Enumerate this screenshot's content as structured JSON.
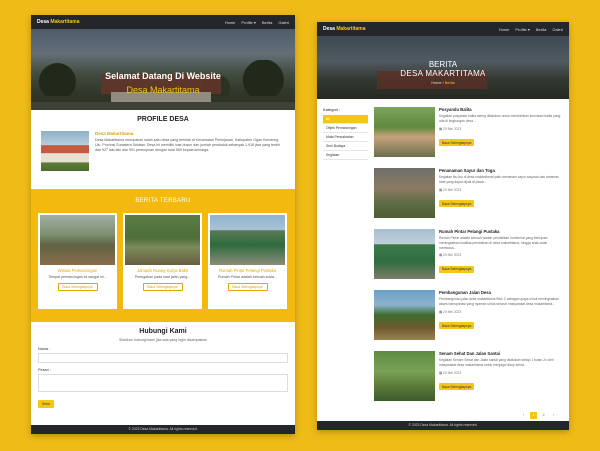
{
  "home": {
    "brand": {
      "first": "Desa",
      "second": "Makartitama"
    },
    "nav": [
      "Home",
      "Profile ▾",
      "Berita",
      "Galeri"
    ],
    "hero": {
      "title": "Selamat Datang Di Website",
      "subtitle": "Desa Makartitama"
    },
    "profile": {
      "title": "PROFILE DESA",
      "name": "Desa Makartitama",
      "text": "Desa Makartitama merupakan salah satu desa yang terletak di Kecamatan Peninjauan, Kabupaten Ogan Komering Ulu, Provinsi Sumatera Selatan. Desa ini memiliki luas dusun dan jumlah penduduk sebanyak 1.918 jiwa yang terdiri dari 927 laki-laki dan 991 perempuan dengan total 569 kepala keluarga."
    },
    "news": {
      "title": "BERITA TERBARU",
      "cards": [
        {
          "title": "Wisata Pemancingan",
          "text": "Tempat pemancingan ini sangat ini...",
          "button": "Baca Selengkapnya"
        },
        {
          "title": "Jamaah Ruang Karya Bakti",
          "text": "Pertugakan pada saat jalan yang...",
          "button": "Baca Selengkapnya"
        },
        {
          "title": "Rumah Pintar Pelangi Pustaka",
          "text": "Rumah Pintar adalah sebuah sosia...",
          "button": "Baca Selengkapnya"
        }
      ]
    },
    "contact": {
      "title": "Hubungi Kami",
      "subtitle": "Silahkan hubungi kami jika ada yang ingin disampaikan",
      "name_label": "Nama :",
      "pesan_label": "Pesan :",
      "send": "Kirim"
    },
    "footer": "© 2023 Desa Makartitama. All rights reserved."
  },
  "news_page": {
    "brand": {
      "first": "Desa",
      "second": "Makartitama"
    },
    "nav": [
      "Home",
      "Profile ▾",
      "Berita",
      "Galeri"
    ],
    "hero": {
      "title": "BERITA",
      "subtitle": "DESA MAKARTITAMA",
      "crumb_home": "Home",
      "crumb_sep": " / ",
      "crumb_current": "Berita"
    },
    "categories": {
      "title": "Kategori :",
      "items": [
        "All",
        "Objek Pemancingan",
        "Mata Pencaharian",
        "Seni Budaya",
        "Kegiatan"
      ]
    },
    "items": [
      {
        "title": "Posyandu Balita",
        "text": "Kegiatan posyandu balita sering dilakukan untuk memberikan imunisasi balita yang ada di lingkungan desa...",
        "date": "20 Mei 2023",
        "button": "Baca Selengkapnya"
      },
      {
        "title": "Penanaman Sayur dan Toga",
        "text": "Kegiatan ibu-ibu di desa makartitama yaitu menanam sayur-sayuran dan tanaman obat yang dapat dijual di pasar...",
        "date": "20 Mei 2023",
        "button": "Baca Selengkapnya"
      },
      {
        "title": "Rumah Pintar Pelangi Pustaka",
        "text": "Rumah Pintar adalah sebuah wadah pendidikan nonformal yang bertujuan meningkatkan kualitas pendidikan di desa makartitama, hingga anak-anak membaca...",
        "date": "20 Mei 2023",
        "button": "Baca Selengkapnya"
      },
      {
        "title": "Pembangunan Jalan Desa",
        "text": "Pembangunan jalan desa makartitama Blok C sebagai upaya untuk meningkatkan akses transportasi yang nyaman untuk seluruh masyarakat desa makartitama...",
        "date": "20 Mei 2023",
        "button": "Baca Selengkapnya"
      },
      {
        "title": "Senam Sehat Dan Jalan Santai",
        "text": "Kegiatan Senam Sehat dan Jalan santai yang dilakukan setiap 1 bulan 2x oleh masyarakat desa makartitama untuk menjaga hidup sehat...",
        "date": "20 Mei 2023",
        "button": "Baca Selengkapnya"
      }
    ],
    "pager": [
      "‹",
      "1",
      "2",
      "›"
    ],
    "footer": "© 2023 Desa Makartitama. All rights reserved."
  },
  "colors": {
    "background": "#efbb17",
    "accent": "#f5c518",
    "nav": "#23272b"
  }
}
